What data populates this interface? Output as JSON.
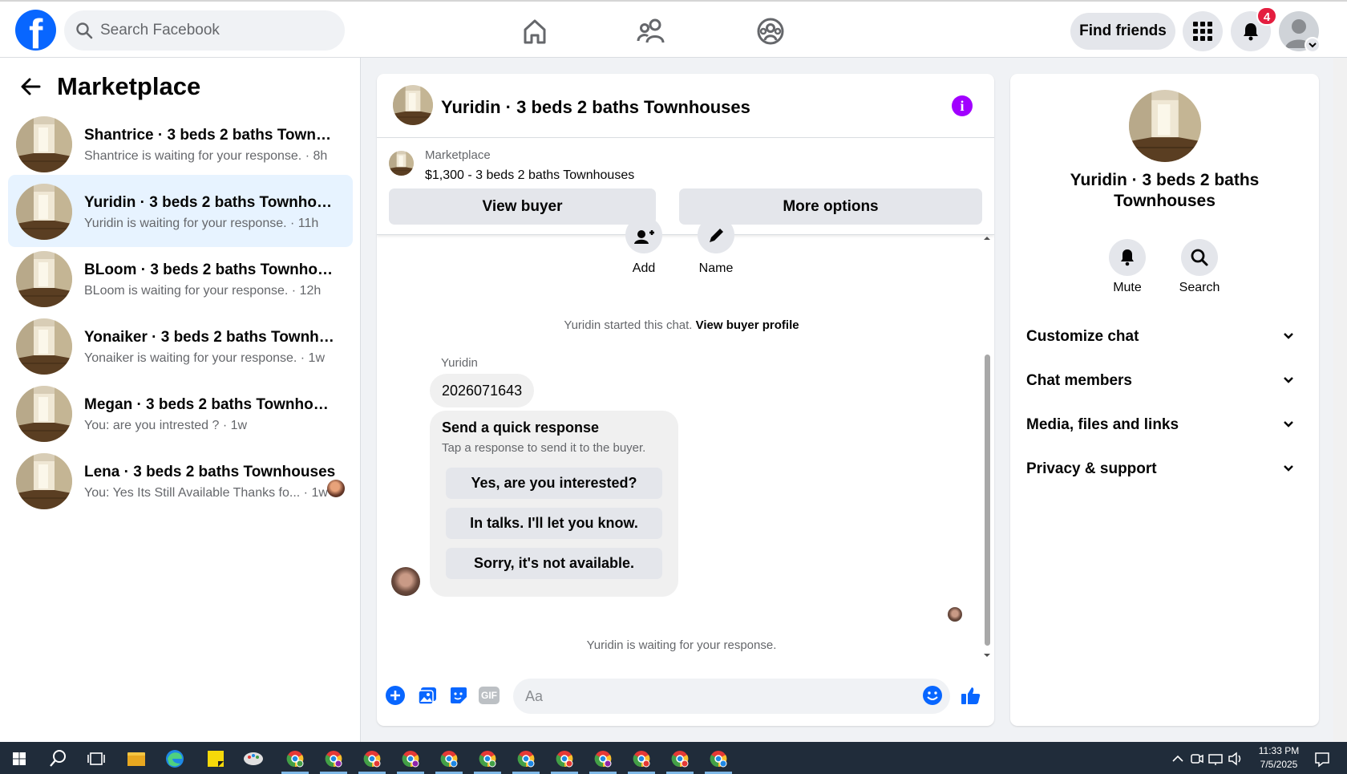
{
  "header": {
    "logo_letter": "f",
    "search_placeholder": "Search Facebook",
    "find_friends_label": "Find friends",
    "notification_count": "4"
  },
  "sidebar": {
    "title": "Marketplace",
    "conversations": [
      {
        "name": "Shantrice · 3 beds 2 baths Townho...",
        "preview": "Shantrice is waiting for your response. · 8h",
        "active": false
      },
      {
        "name": "Yuridin · 3 beds 2 baths Townhouses",
        "preview": "Yuridin is waiting for your response. · 11h",
        "active": true
      },
      {
        "name": "BLoom · 3 beds 2 baths Townhouses",
        "preview": "BLoom is waiting for your response. · 12h",
        "active": false
      },
      {
        "name": "Yonaiker · 3 beds 2 baths Townhou...",
        "preview": "Yonaiker is waiting for your response. · 1w",
        "active": false
      },
      {
        "name": "Megan · 3 beds 2 baths Townhouses",
        "preview": "You: are you intrested ? · 1w",
        "active": false
      },
      {
        "name": "Lena · 3 beds 2 baths Townhouses",
        "preview": "You: Yes Its Still Available Thanks fo... · 1w",
        "active": false
      }
    ]
  },
  "chat": {
    "title": "Yuridin · 3 beds 2 baths Townhouses",
    "listing_label": "Marketplace",
    "listing_price": "$1,300 - 3 beds 2 baths Townhouses",
    "view_buyer_label": "View buyer",
    "more_options_label": "More options",
    "add_label": "Add",
    "name_label": "Name",
    "started_text": "Yuridin started this chat.",
    "view_profile_link": "View buyer profile",
    "sender_name": "Yuridin",
    "message_text": "2026071643",
    "quick_title": "Send a quick response",
    "quick_subtitle": "Tap a response to send it to the buyer.",
    "quick_responses": [
      "Yes, are you interested?",
      "In talks. I'll let you know.",
      "Sorry, it's not available."
    ],
    "waiting_text": "Yuridin is waiting for your response.",
    "composer_placeholder": "Aa",
    "gif_label": "GIF"
  },
  "details": {
    "title": "Yuridin · 3 beds 2 baths Townhouses",
    "mute_label": "Mute",
    "search_label": "Search",
    "sections": [
      "Customize chat",
      "Chat members",
      "Media, files and links",
      "Privacy & support"
    ]
  },
  "taskbar": {
    "time": "11:33 PM",
    "date": "7/5/2025"
  },
  "colors": {
    "brand": "#0866ff",
    "active_bg": "#e7f3ff",
    "info": "#a100ff",
    "badge": "#e41e3f"
  }
}
